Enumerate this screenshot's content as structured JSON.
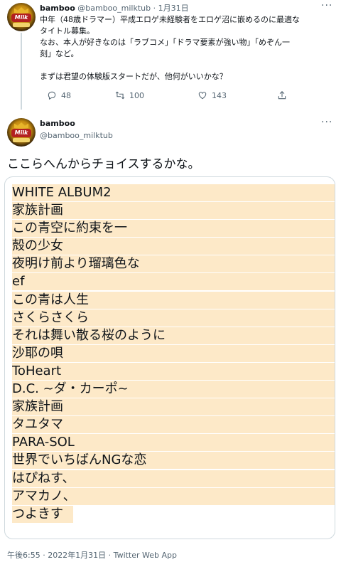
{
  "tweet1": {
    "author_name": "bamboo",
    "handle": "@bamboo_milktub",
    "dot": "·",
    "date": "1月31日",
    "more": "···",
    "lines": [
      "中年（48歳ドラマー）平成エロゲ未経験者をエロゲ沼に嵌めるのに最適な",
      "タイトル募集。",
      "なお、本人が好きなのは「ラブコメ」「ドラマ要素が強い物」「めぞん一",
      "刻」など。",
      "",
      "まずは君望の体験版スタートだが、他何がいいかな？"
    ],
    "reply_count": "48",
    "retweet_count": "100",
    "like_count": "143"
  },
  "tweet2": {
    "author_name": "bamboo",
    "handle": "@bamboo_milktub",
    "more": "···",
    "text": "ここらへんからチョイスするかな。",
    "image_lines": [
      "WHITE ALBUM2",
      "家族計画",
      "この青空に約束を一",
      "殻の少女",
      "夜明け前より瑠璃色な",
      "ef",
      "この青は人生",
      "さくらさくら",
      "それは舞い散る桜のように",
      "沙耶の唄",
      "ToHeart",
      "D.C. ~ダ・カーポ~",
      "家族計画",
      "タユタマ",
      "PARA-SOL",
      "世界でいちばんNGな恋",
      "はぴねす、",
      "アマカノ、",
      "つよきす"
    ],
    "timestamp": "午後6:55 · 2022年1月31日 · Twitter Web App"
  },
  "avatar_mark": "Milk",
  "colors": {
    "highlight": "#fde9c8",
    "secondary_text": "#536471",
    "border": "#cfd9de"
  }
}
